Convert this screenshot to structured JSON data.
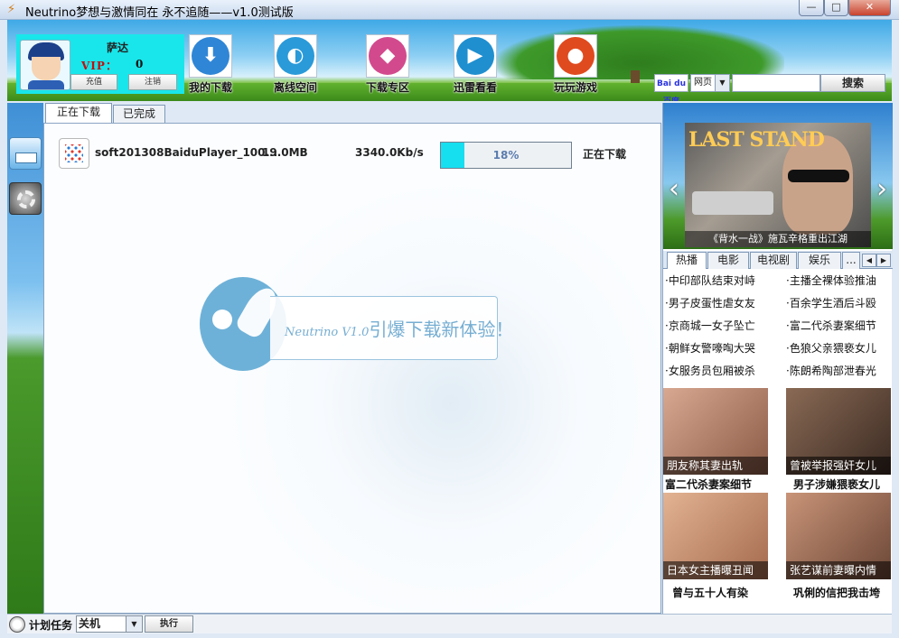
{
  "window": {
    "title": "Neutrino梦想与激情同在  永不追随——v1.0测试版",
    "min_label": "—",
    "max_label": "□",
    "close_label": "✕"
  },
  "user": {
    "name": "萨达",
    "vip_label": "VIP：",
    "vip_value": "0",
    "recharge_label": "充值",
    "logout_label": "注销"
  },
  "nav": [
    {
      "label": "我的下载",
      "icon": "download-arrow-icon",
      "color": "#2f86d6"
    },
    {
      "label": "离线空间",
      "icon": "cloud-disc-icon",
      "color": "#2a9ad9"
    },
    {
      "label": "下载专区",
      "icon": "cube-icon",
      "color": "#d24a8d"
    },
    {
      "label": "迅雷看看",
      "icon": "play-circle-icon",
      "color": "#1f8fd0"
    },
    {
      "label": "玩玩游戏",
      "icon": "joystick-icon",
      "color": "#e04a1f"
    }
  ],
  "search": {
    "logo": "Bai du 百度",
    "type": "网页",
    "value": "",
    "button": "搜索"
  },
  "tabs": {
    "downloading": "正在下载",
    "completed": "已完成"
  },
  "task": {
    "name": "soft201308BaiduPlayer_100...",
    "size": "19.0MB",
    "speed": "3340.0Kb/s",
    "progress": 18,
    "progress_label": "18%",
    "status": "正在下载"
  },
  "promo": {
    "brand": "Neutrino V1.0",
    "slogan": "引爆下载新体验！"
  },
  "movie": {
    "poster_title": "LAST STAND",
    "caption": "《背水一战》施瓦辛格重出江湖"
  },
  "news_tabs": [
    "热播",
    "电影",
    "电视剧",
    "娱乐",
    "..."
  ],
  "news": [
    [
      "·中印部队结束对峙",
      "·主播全裸体验推油"
    ],
    [
      "·男子皮蛋性虐女友",
      "·百余学生酒后斗殴"
    ],
    [
      "·京商城一女子坠亡",
      "·富二代杀妻案细节"
    ],
    [
      "·朝鲜女警嚎啕大哭",
      "·色狼父亲猥亵女儿"
    ],
    [
      "·女服务员包厢被杀",
      "·陈朗希陶部泄春光"
    ]
  ],
  "thumbs": [
    {
      "caption": "朋友称其妻出轨",
      "title": "富二代杀妻案细节",
      "color": "#c98a72"
    },
    {
      "caption": "曾被举报强奸女儿",
      "title": "男子涉嫌猥亵女儿",
      "color": "#7a5a47"
    },
    {
      "caption": "日本女主播曝丑闻",
      "title": "曾与五十人有染",
      "color": "#d09a7c"
    },
    {
      "caption": "张艺谋前妻曝内情",
      "title": "巩俐的信把我击垮",
      "color": "#b78063"
    }
  ],
  "status": {
    "plan_label": "计划任务",
    "plan_value": "关机",
    "exec_label": "执行"
  }
}
